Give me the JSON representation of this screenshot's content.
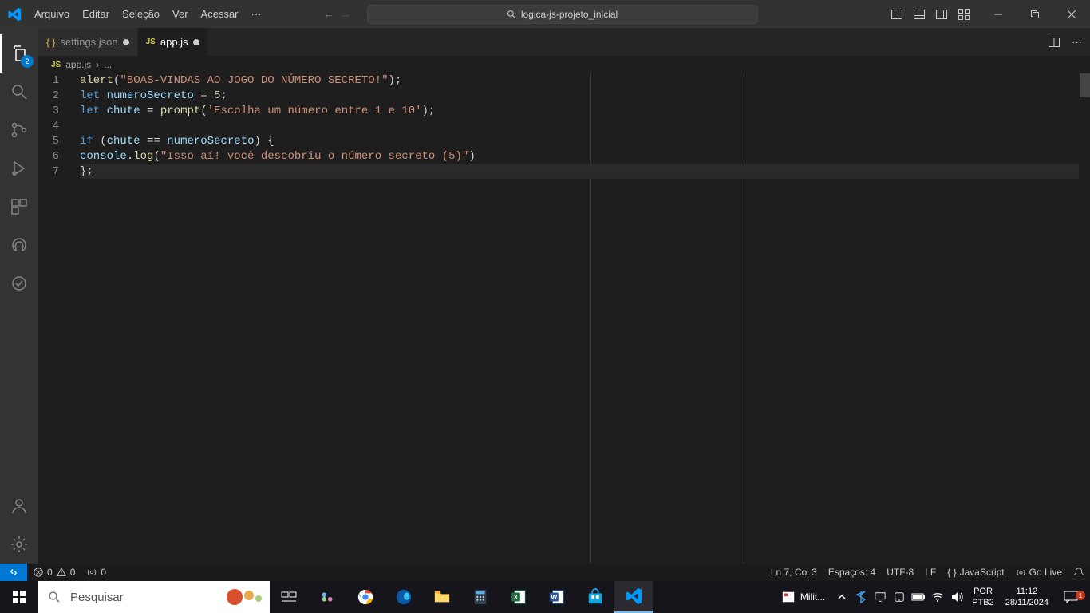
{
  "titlebar": {
    "menus": [
      "Arquivo",
      "Editar",
      "Seleção",
      "Ver",
      "Acessar"
    ],
    "search_label": "logica-js-projeto_inicial"
  },
  "activitybar": {
    "explorer_badge": "2"
  },
  "tabs": {
    "items": [
      {
        "label": "settings.json",
        "dirty": true
      },
      {
        "label": "app.js",
        "dirty": true
      }
    ]
  },
  "breadcrumb": {
    "file": "app.js",
    "sep": "›",
    "tail": "..."
  },
  "code": {
    "lines": [
      {
        "n": "1",
        "tokens": [
          {
            "c": "fn",
            "t": "alert"
          },
          {
            "c": "pun",
            "t": "("
          },
          {
            "c": "str",
            "t": "\"BOAS-VINDAS AO JOGO DO NÚMERO SECRETO!\""
          },
          {
            "c": "pun",
            "t": ");"
          }
        ]
      },
      {
        "n": "2",
        "tokens": [
          {
            "c": "kw",
            "t": "let"
          },
          {
            "c": "pun",
            "t": " "
          },
          {
            "c": "var",
            "t": "numeroSecreto"
          },
          {
            "c": "pun",
            "t": " "
          },
          {
            "c": "op",
            "t": "="
          },
          {
            "c": "pun",
            "t": " "
          },
          {
            "c": "num",
            "t": "5"
          },
          {
            "c": "pun",
            "t": ";"
          }
        ]
      },
      {
        "n": "3",
        "tokens": [
          {
            "c": "kw",
            "t": "let"
          },
          {
            "c": "pun",
            "t": " "
          },
          {
            "c": "var",
            "t": "chute"
          },
          {
            "c": "pun",
            "t": " "
          },
          {
            "c": "op",
            "t": "="
          },
          {
            "c": "pun",
            "t": " "
          },
          {
            "c": "fn",
            "t": "prompt"
          },
          {
            "c": "pun",
            "t": "("
          },
          {
            "c": "str",
            "t": "'Escolha um número entre 1 e 10'"
          },
          {
            "c": "pun",
            "t": ");"
          }
        ]
      },
      {
        "n": "4",
        "tokens": []
      },
      {
        "n": "5",
        "tokens": [
          {
            "c": "kw",
            "t": "if"
          },
          {
            "c": "pun",
            "t": " ("
          },
          {
            "c": "var",
            "t": "chute"
          },
          {
            "c": "pun",
            "t": " "
          },
          {
            "c": "op",
            "t": "=="
          },
          {
            "c": "pun",
            "t": " "
          },
          {
            "c": "var",
            "t": "numeroSecreto"
          },
          {
            "c": "pun",
            "t": ") {"
          }
        ]
      },
      {
        "n": "6",
        "tokens": [
          {
            "c": "obj",
            "t": "console"
          },
          {
            "c": "pun",
            "t": "."
          },
          {
            "c": "fn",
            "t": "log"
          },
          {
            "c": "pun",
            "t": "("
          },
          {
            "c": "str",
            "t": "\"Isso aí! você descobriu o número secreto (5)\""
          },
          {
            "c": "pun",
            "t": ")"
          }
        ]
      },
      {
        "n": "7",
        "current": true,
        "tokens": [
          {
            "c": "pun",
            "t": "};"
          }
        ]
      }
    ]
  },
  "statusbar": {
    "errors": "0",
    "warnings": "0",
    "ports": "0",
    "cursor": "Ln 7, Col 3",
    "spaces": "Espaços: 4",
    "encoding": "UTF-8",
    "eol": "LF",
    "lang": "JavaScript",
    "golive": "Go Live"
  },
  "taskbar": {
    "search_placeholder": "Pesquisar",
    "app_label": "Milit...",
    "lang1": "POR",
    "lang2": "PTB2",
    "time": "11:12",
    "date": "28/11/2024"
  }
}
